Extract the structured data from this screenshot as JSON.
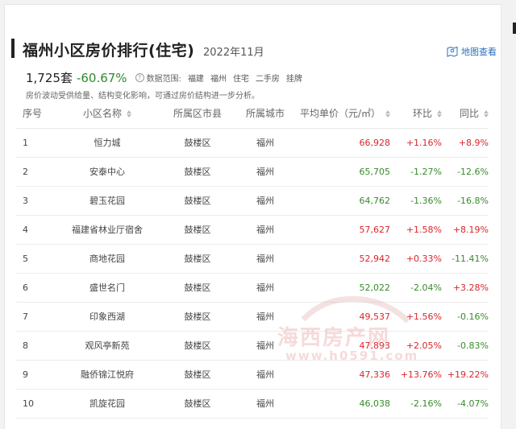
{
  "header": {
    "title": "福州小区房价排行(住宅)",
    "date": "2022年11月",
    "map_link": "地图查看",
    "map_icon": "map-location-icon"
  },
  "summary": {
    "count": "1,725套",
    "change": "-60.67%",
    "help_icon": "question-circle-icon",
    "scope_label": "数据范围:",
    "scope_items": [
      "福建",
      "福州",
      "住宅",
      "二手房",
      "挂牌"
    ],
    "note": "房价波动受供给量、结构变化影响，可通过房价结构进一步分析。"
  },
  "colors": {
    "up": "#d9262c",
    "down": "#3a8a2e",
    "accent": "#2a6fbf"
  },
  "table": {
    "columns": [
      "序号",
      "小区名称",
      "所属区市县",
      "所属城市",
      "平均单价（元/㎡）",
      "环比",
      "同比"
    ],
    "rows": [
      {
        "rank": "1",
        "name": "恒力城",
        "district": "鼓楼区",
        "city": "福州",
        "price": "66,928",
        "mom": "+1.16%",
        "yoy": "+8.9%"
      },
      {
        "rank": "2",
        "name": "安泰中心",
        "district": "鼓楼区",
        "city": "福州",
        "price": "65,705",
        "mom": "-1.27%",
        "yoy": "-12.6%"
      },
      {
        "rank": "3",
        "name": "碧玉花园",
        "district": "鼓楼区",
        "city": "福州",
        "price": "64,762",
        "mom": "-1.36%",
        "yoy": "-16.8%"
      },
      {
        "rank": "4",
        "name": "福建省林业厅宿舍",
        "district": "鼓楼区",
        "city": "福州",
        "price": "57,627",
        "mom": "+1.58%",
        "yoy": "+8.19%"
      },
      {
        "rank": "5",
        "name": "商地花园",
        "district": "鼓楼区",
        "city": "福州",
        "price": "52,942",
        "mom": "+0.33%",
        "yoy": "-11.41%"
      },
      {
        "rank": "6",
        "name": "盛世名门",
        "district": "鼓楼区",
        "city": "福州",
        "price": "52,022",
        "mom": "-2.04%",
        "yoy": "+3.28%"
      },
      {
        "rank": "7",
        "name": "印象西湖",
        "district": "鼓楼区",
        "city": "福州",
        "price": "49,537",
        "mom": "+1.56%",
        "yoy": "-0.16%"
      },
      {
        "rank": "8",
        "name": "观风亭新苑",
        "district": "鼓楼区",
        "city": "福州",
        "price": "47,893",
        "mom": "+2.05%",
        "yoy": "-0.83%"
      },
      {
        "rank": "9",
        "name": "融侨锦江悦府",
        "district": "鼓楼区",
        "city": "福州",
        "price": "47,336",
        "mom": "+13.76%",
        "yoy": "+19.22%"
      },
      {
        "rank": "10",
        "name": "凯旋花园",
        "district": "鼓楼区",
        "city": "福州",
        "price": "46,038",
        "mom": "-2.16%",
        "yoy": "-4.07%"
      }
    ]
  },
  "watermark": {
    "text": "海西房产网",
    "url": "www.h0591.com"
  }
}
